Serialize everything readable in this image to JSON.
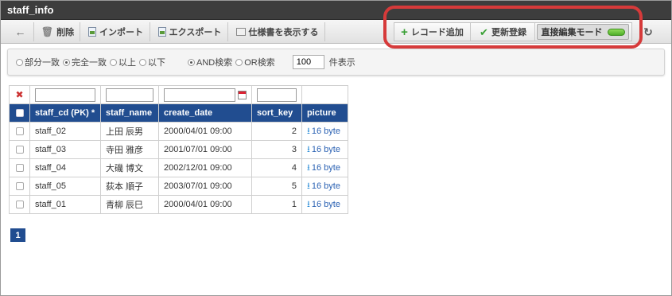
{
  "window": {
    "title": "staff_info"
  },
  "toolbar": {
    "back": "",
    "delete_label": "削除",
    "import_label": "インポート",
    "export_label": "エクスポート",
    "spec_label": "仕様書を表示する",
    "add_record_label": "レコード追加",
    "update_label": "更新登録",
    "direct_edit_label": "直接編集モード",
    "refresh": ""
  },
  "search": {
    "match_partial": "部分一致",
    "match_exact": "完全一致",
    "match_gte": "以上",
    "match_lte": "以下",
    "match_selected": "完全一致",
    "and_label": "AND検索",
    "or_label": "OR検索",
    "logic_selected": "AND検索",
    "count_value": "100",
    "count_suffix": "件表示"
  },
  "table": {
    "columns": [
      "staff_cd (PK) *",
      "staff_name",
      "create_date",
      "sort_key",
      "picture"
    ],
    "rows": [
      {
        "staff_cd": "staff_02",
        "staff_name": "上田 辰男",
        "create_date": "2000/04/01 09:00",
        "sort_key": "2",
        "picture": "16 byte"
      },
      {
        "staff_cd": "staff_03",
        "staff_name": "寺田 雅彦",
        "create_date": "2001/07/01 09:00",
        "sort_key": "3",
        "picture": "16 byte"
      },
      {
        "staff_cd": "staff_04",
        "staff_name": "大磯 博文",
        "create_date": "2002/12/01 09:00",
        "sort_key": "4",
        "picture": "16 byte"
      },
      {
        "staff_cd": "staff_05",
        "staff_name": "荻本 順子",
        "create_date": "2003/07/01 09:00",
        "sort_key": "5",
        "picture": "16 byte"
      },
      {
        "staff_cd": "staff_01",
        "staff_name": "青柳 辰巳",
        "create_date": "2000/04/01 09:00",
        "sort_key": "1",
        "picture": "16 byte"
      }
    ]
  },
  "pager": {
    "current": "1"
  },
  "icons": {
    "back": "arrow-left-icon",
    "delete": "trash-icon",
    "import": "import-icon",
    "export": "export-icon",
    "spec": "document-icon",
    "add": "plus-icon",
    "update": "check-icon",
    "toggle": "toggle-on-icon",
    "refresh": "refresh-icon",
    "download": "download-icon",
    "clear_filter": "clear-filter-icon",
    "calendar": "calendar-icon"
  },
  "colors": {
    "header_bg": "#214d90",
    "accent_green": "#3aa035",
    "highlight": "#d63a3a",
    "title_bg": "#3d3d3d"
  }
}
